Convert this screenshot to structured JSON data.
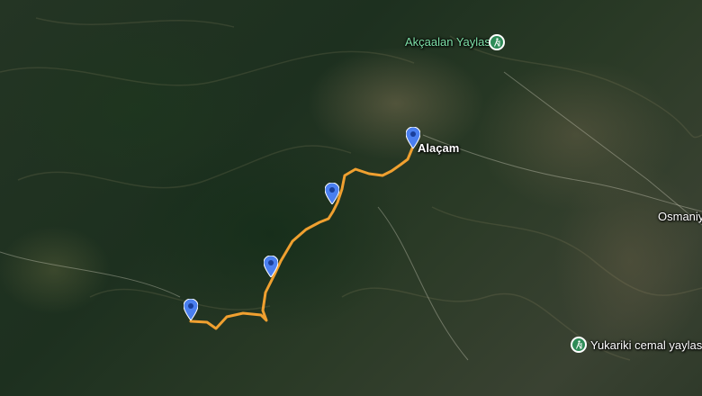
{
  "map": {
    "imagery": "satellite",
    "accent_colors": {
      "route": "#f0a030",
      "pin": "#4a7ff0",
      "poi": "#2e8b57"
    },
    "route": {
      "color": "#f0a030",
      "waypoints": [
        {
          "name": "Alaçam",
          "pin": "blue-pin"
        },
        {
          "name": "waypoint-2",
          "pin": "blue-pin"
        },
        {
          "name": "waypoint-3",
          "pin": "blue-pin"
        },
        {
          "name": "waypoint-4",
          "pin": "blue-pin"
        }
      ]
    },
    "places": {
      "alacam": "Alaçam",
      "osmaniye": "Osmaniye",
      "akcaalan": "Akçaalan Yaylası",
      "yukariki": "Yukariki cemal yaylası"
    },
    "poi_icon": "hiking-icon"
  }
}
